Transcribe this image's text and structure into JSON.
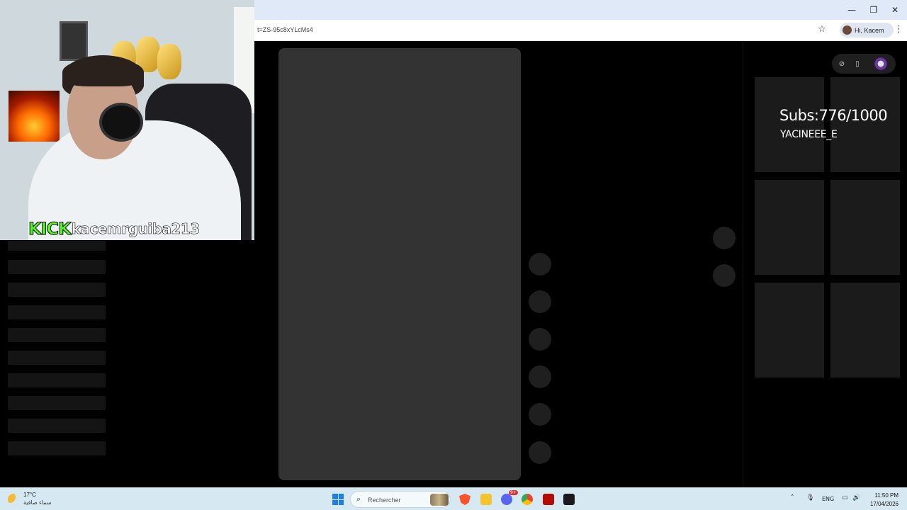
{
  "browser": {
    "url": "t=ZS-95c8xYLcMs4",
    "profile_label": "Hi, Kacem",
    "window_controls": [
      "—",
      "❐",
      "✕"
    ]
  },
  "overlay": {
    "kick_brand": "KICK",
    "kick_handle": "kacemrguiba213",
    "subs_counter": "Subs:776/1000",
    "last_subscriber": "YACINEEE_E"
  },
  "taskbar": {
    "weather_temp": "17°C",
    "weather_desc": "سماء صافية",
    "search_placeholder": "Rechercher",
    "language": "ENG",
    "time": "11:50 PM",
    "date": "17/04/2026",
    "apps": [
      "brave-icon",
      "file-explorer-icon",
      "discord-icon",
      "chrome-icon",
      "adobe-icon",
      "terminal-icon"
    ],
    "discord_badge": "9+"
  },
  "colors": {
    "kick_green": "#53fc18",
    "skeleton": "#333333",
    "taskbar_bg": "#d6e9f2"
  }
}
